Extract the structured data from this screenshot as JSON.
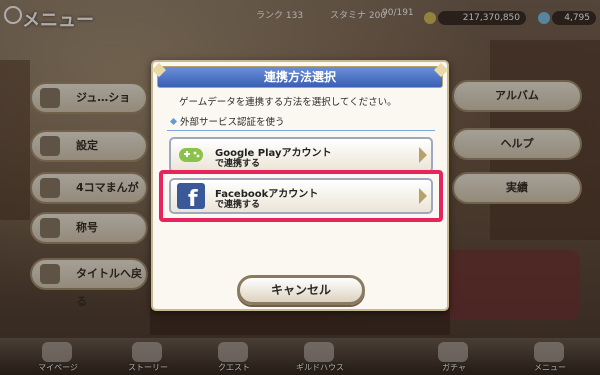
{
  "topbar": {
    "menu_title": "メニュー",
    "stamina_label": "スタミナ",
    "stamina_value": "200",
    "level_label": "ランク",
    "level_value": "133",
    "exp_value": "90/191",
    "mana": "217,370,850",
    "jewels": "4,795"
  },
  "left_menu": [
    {
      "label": "ジュ…ショ"
    },
    {
      "label": "設定"
    },
    {
      "label": "4コマまんが"
    },
    {
      "label": "称号"
    },
    {
      "label": "タイトルへ戻る"
    }
  ],
  "right_menu": [
    {
      "label": "アルバム"
    },
    {
      "label": "ヘルプ"
    },
    {
      "label": "実績"
    }
  ],
  "dialog": {
    "title": "連携方法選択",
    "description": "ゲームデータを連携する方法を選択してください。",
    "section_label": "外部サービス認証を使う",
    "google_line1": "Google Playアカウント",
    "google_line2": "で連携する",
    "facebook_line1": "Facebookアカウント",
    "facebook_line2": "で連携する",
    "cancel_label": "キャンセル"
  },
  "tabs": [
    {
      "label": "マイページ"
    },
    {
      "label": "ストーリー"
    },
    {
      "label": "クエスト"
    },
    {
      "label": "ギルドハウス"
    },
    {
      "label": "ガチャ"
    },
    {
      "label": "メニュー"
    }
  ],
  "colors": {
    "highlight": "#e8245e",
    "header_blue": "#3a5fb4",
    "facebook_blue": "#3b5998",
    "google_green": "#8bc34a"
  }
}
